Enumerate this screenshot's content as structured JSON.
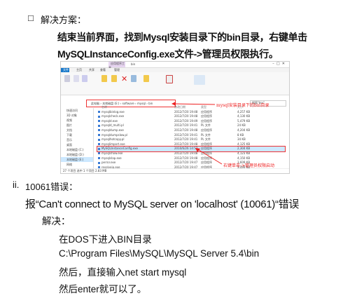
{
  "section1": {
    "bullet": "□",
    "heading": "解决方案：",
    "line1": "结束当前界面，找到Mysql安装目录下的bin目录，右键单击",
    "line2": "MySQLInstanceConfig.exe文件->管理员权限执行。"
  },
  "screenshot": {
    "window_title": "bin",
    "context_tab": "应用程序工具",
    "ribbon_tabs": [
      "文件",
      "主页",
      "共享",
      "查看",
      "管理"
    ],
    "address": [
      "此电脑",
      "本地磁盘 (E:)",
      "software",
      "mysql",
      "bin"
    ],
    "search_placeholder": "搜索\"bin\"",
    "nav": [
      "快速访问",
      "3D 对象",
      "视频",
      "图片",
      "文档",
      "下载",
      "音乐",
      "桌面",
      "本地磁盘 (C:)",
      "本地磁盘 (D:)",
      "本地磁盘 (E:)",
      "网络"
    ],
    "headers": [
      "名称",
      "修改日期",
      "类型",
      "大小"
    ],
    "files": [
      {
        "name": "mysqlbinlog.exe",
        "date": "2012/7/20 19:48",
        "type": "应用程序",
        "size": "4,257 KB"
      },
      {
        "name": "mysqlcheck.exe",
        "date": "2012/7/20 19:48",
        "type": "应用程序",
        "size": "4,130 KB"
      },
      {
        "name": "mysqld.exe",
        "date": "2012/7/20 19:49",
        "type": "应用程序",
        "size": "5,479 KB"
      },
      {
        "name": "mysqld_multi.pl",
        "date": "2012/7/20 19:41",
        "type": "PL 文件",
        "size": "24 KB"
      },
      {
        "name": "mysqldump.exe",
        "date": "2012/7/20 19:48",
        "type": "应用程序",
        "size": "4,204 KB"
      },
      {
        "name": "mysqldumpslow.pl",
        "date": "2012/7/20 19:41",
        "type": "PL 文件",
        "size": "8 KB"
      },
      {
        "name": "mysqlhotcopy.pl",
        "date": "2012/7/20 19:41",
        "type": "PL 文件",
        "size": "34 KB"
      },
      {
        "name": "mysqlimport.exe",
        "date": "2012/7/20 19:48",
        "type": "应用程序",
        "size": "4,125 KB"
      },
      {
        "name": "MySQLInstanceConfig.exe",
        "date": "2010/6/26 14:57",
        "type": "应用程序",
        "size": "2,304 KB"
      },
      {
        "name": "mysqlshow.exe",
        "date": "2012/7/20 19:48",
        "type": "应用程序",
        "size": "4,123 KB"
      },
      {
        "name": "mysqlslap.exe",
        "date": "2012/7/20 19:48",
        "type": "应用程序",
        "size": "4,150 KB"
      },
      {
        "name": "perror.exe",
        "date": "2012/7/20 19:47",
        "type": "应用程序",
        "size": "3,609 KB"
      },
      {
        "name": "resolveip.exe",
        "date": "2012/7/20 19:47",
        "type": "应用程序",
        "size": "3,499 KB"
      }
    ],
    "status": "27 个项目    选中 1 个项目 2.83 MB",
    "annotation_bin": "mysql安装目录下的bin目录",
    "annotation_run": "右键单击->管理员权限启动"
  },
  "section2": {
    "number": "ii.",
    "heading": "10061错误：",
    "error": "报“Can't connect to MySQL server on 'localhost' (10061)“错误",
    "solve": "解决：",
    "steps": [
      "在DOS下进入BIN目录",
      "C:\\Program Files\\MySQL\\MySQL Server 5.4\\bin",
      "然后，直接输入net start mysql",
      "然后enter就可以了。"
    ]
  }
}
